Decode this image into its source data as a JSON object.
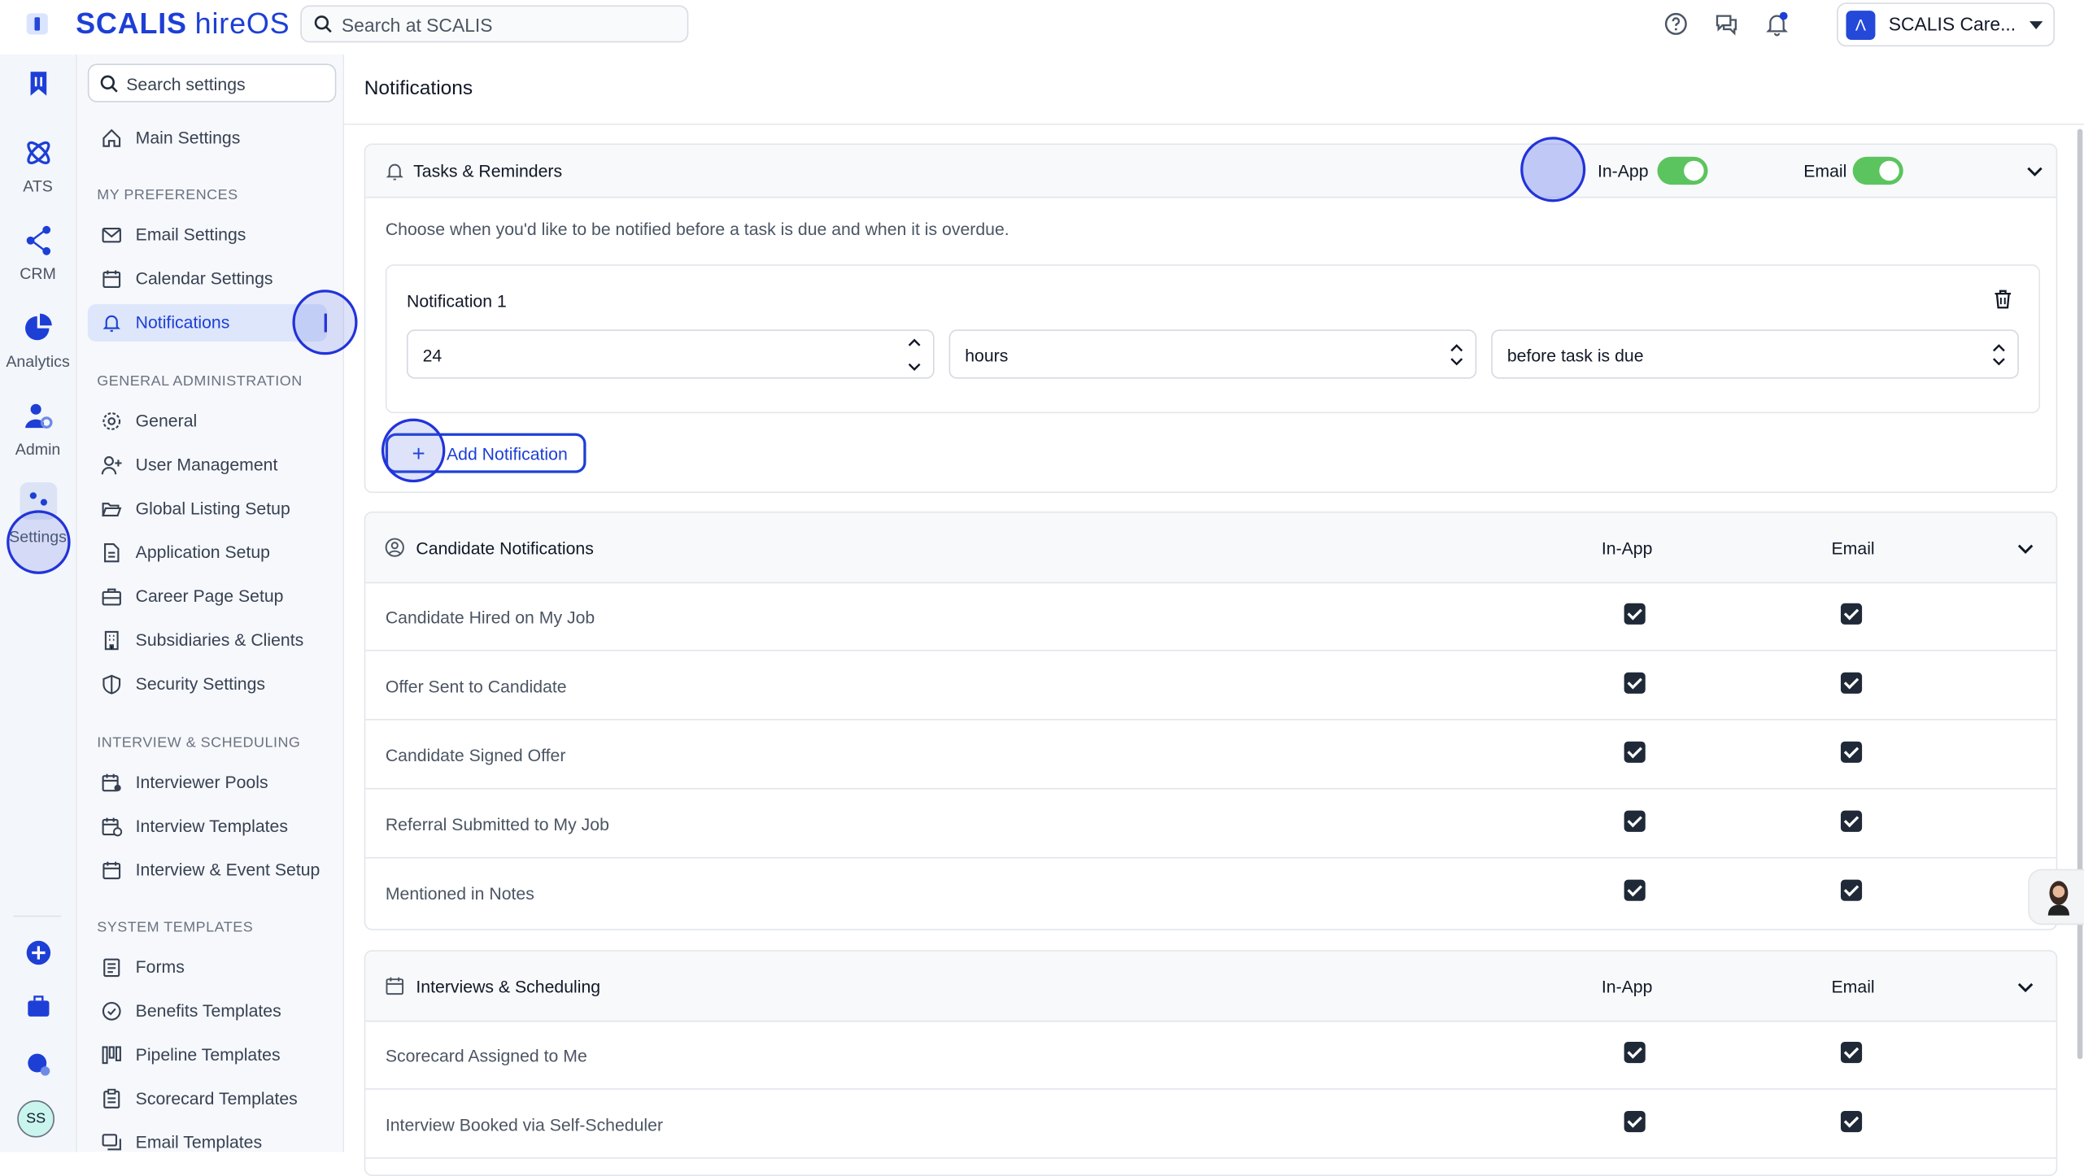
{
  "app": {
    "brand": "SCALIS",
    "product": "hireOS",
    "search_placeholder": "Search at SCALIS",
    "account_name": "SCALIS Care..."
  },
  "rail": {
    "items": [
      {
        "label": "",
        "icon": "bookmark-icon"
      },
      {
        "label": "ATS",
        "icon": "atom-icon"
      },
      {
        "label": "CRM",
        "icon": "network-icon"
      },
      {
        "label": "Analytics",
        "icon": "pie-chart-icon"
      },
      {
        "label": "Admin",
        "icon": "user-gear-icon"
      },
      {
        "label": "Settings",
        "icon": "settings-icon"
      }
    ],
    "avatar_initials": "SS"
  },
  "settings_nav": {
    "search_placeholder": "Search settings",
    "main_settings": "Main Settings",
    "groups": [
      {
        "title": "MY PREFERENCES",
        "items": [
          "Email Settings",
          "Calendar Settings",
          "Notifications"
        ]
      },
      {
        "title": "GENERAL ADMINISTRATION",
        "items": [
          "General",
          "User Management",
          "Global Listing Setup",
          "Application Setup",
          "Career Page Setup",
          "Subsidiaries & Clients",
          "Security Settings"
        ]
      },
      {
        "title": "INTERVIEW & SCHEDULING",
        "items": [
          "Interviewer Pools",
          "Interview Templates",
          "Interview & Event Setup"
        ]
      },
      {
        "title": "SYSTEM TEMPLATES",
        "items": [
          "Forms",
          "Benefits Templates",
          "Pipeline Templates",
          "Scorecard Templates",
          "Email Templates"
        ]
      }
    ],
    "active_item": "Notifications"
  },
  "main": {
    "title": "Notifications",
    "tasks": {
      "title": "Tasks & Reminders",
      "in_app_label": "In-App",
      "email_label": "Email",
      "in_app_enabled": true,
      "email_enabled": true,
      "description": "Choose when you'd like to be notified before a task is due and when it is overdue.",
      "notification": {
        "title": "Notification 1",
        "amount": "24",
        "unit": "hours",
        "when": "before task is due"
      },
      "add_button": "Add Notification"
    },
    "candidate": {
      "title": "Candidate Notifications",
      "in_app_label": "In-App",
      "email_label": "Email",
      "rows": [
        {
          "label": "Candidate Hired on My Job",
          "in_app": true,
          "email": true
        },
        {
          "label": "Offer Sent to Candidate",
          "in_app": true,
          "email": true
        },
        {
          "label": "Candidate Signed Offer",
          "in_app": true,
          "email": true
        },
        {
          "label": "Referral Submitted to My Job",
          "in_app": true,
          "email": true
        },
        {
          "label": "Mentioned in Notes",
          "in_app": true,
          "email": true
        }
      ]
    },
    "interviews": {
      "title": "Interviews & Scheduling",
      "in_app_label": "In-App",
      "email_label": "Email",
      "rows": [
        {
          "label": "Scorecard Assigned to Me",
          "in_app": true,
          "email": true
        },
        {
          "label": "Interview Booked via Self-Scheduler",
          "in_app": true,
          "email": true
        }
      ]
    }
  },
  "colors": {
    "brand": "#1d3fd6",
    "toggle_on": "#5cc45e",
    "active_nav_bg": "#dde6fb"
  }
}
